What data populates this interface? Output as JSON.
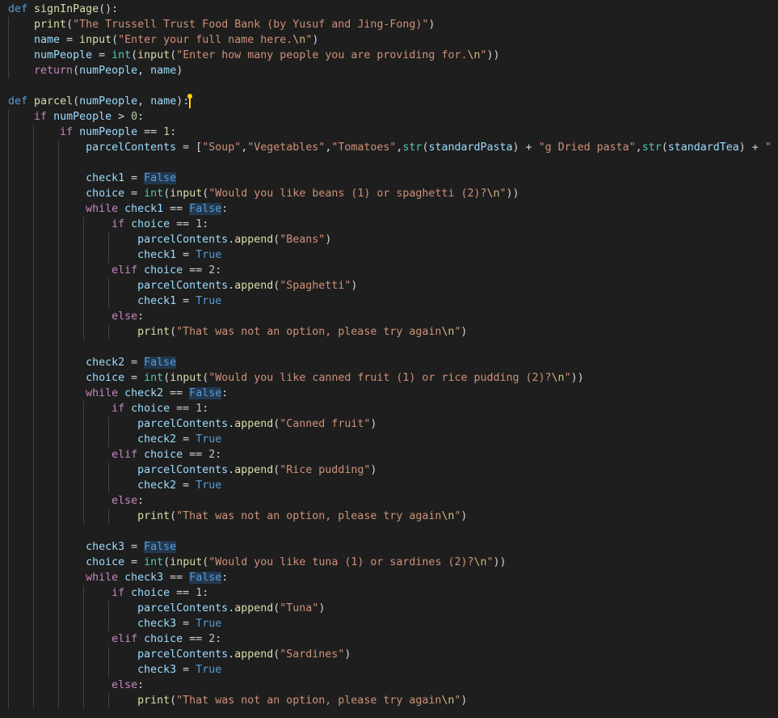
{
  "editor": {
    "theme_background": "#1e1e1e",
    "lines": [
      "def signInPage():",
      "    print(\"The Trussell Trust Food Bank (by Yusuf and Jing-Fong)\")",
      "    name = input(\"Enter your full name here.\\n\")",
      "    numPeople = int(input(\"Enter how many people you are providing for.\\n\"))",
      "    return(numPeople, name)",
      "",
      "def parcel(numPeople, name):",
      "    if numPeople > 0:",
      "        if numPeople == 1:",
      "            parcelContents = [\"Soup\",\"Vegetables\",\"Tomatoes\",str(standardPasta) + \"g Dried pasta\",str(standardTea) + \" Tea b",
      "",
      "            check1 = False",
      "            choice = int(input(\"Would you like beans (1) or spaghetti (2)?\\n\"))",
      "            while check1 == False:",
      "                if choice == 1:",
      "                    parcelContents.append(\"Beans\")",
      "                    check1 = True",
      "                elif choice == 2:",
      "                    parcelContents.append(\"Spaghetti\")",
      "                    check1 = True",
      "                else:",
      "                    print(\"That was not an option, please try again\\n\")",
      "",
      "            check2 = False",
      "            choice = int(input(\"Would you like canned fruit (1) or rice pudding (2)?\\n\"))",
      "            while check2 == False:",
      "                if choice == 1:",
      "                    parcelContents.append(\"Canned fruit\")",
      "                    check2 = True",
      "                elif choice == 2:",
      "                    parcelContents.append(\"Rice pudding\")",
      "                    check2 = True",
      "                else:",
      "                    print(\"That was not an option, please try again\\n\")",
      "",
      "            check3 = False",
      "            choice = int(input(\"Would you like tuna (1) or sardines (2)?\\n\"))",
      "            while check3 == False:",
      "                if choice == 1:",
      "                    parcelContents.append(\"Tuna\")",
      "                    check3 = True",
      "                elif choice == 2:",
      "                    parcelContents.append(\"Sardines\")",
      "                    check3 = True",
      "                else:",
      "                    print(\"That was not an option, please try again\\n\")"
    ],
    "text_cursor_line": 7
  },
  "colors": {
    "keyword": "#569cd6",
    "control": "#c586c0",
    "function": "#dcdcaa",
    "variable": "#9cdcfe",
    "string": "#ce9178",
    "number": "#b5cea8",
    "builtin": "#4ec9b0",
    "cursor": "#ffd700"
  }
}
